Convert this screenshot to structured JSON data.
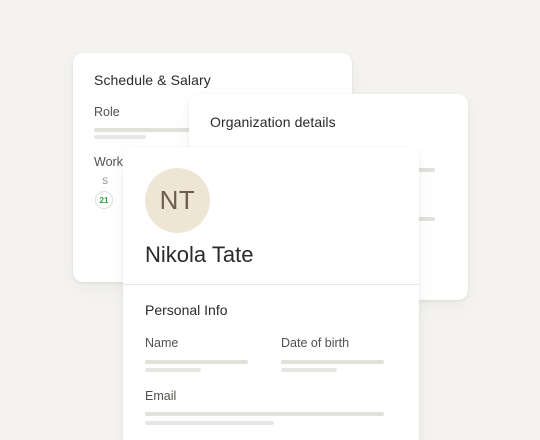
{
  "schedule_card": {
    "title": "Schedule & Salary",
    "role_label": "Role",
    "work_label": "Work",
    "day_letter": "S",
    "day_number": "21"
  },
  "org_card": {
    "title": "Organization details"
  },
  "profile_card": {
    "initials": "NT",
    "name": "Nikola Tate",
    "section_title": "Personal Info",
    "fields": {
      "name_label": "Name",
      "dob_label": "Date of birth",
      "email_label": "Email"
    }
  },
  "colors": {
    "background": "#f4f3f0",
    "card": "#ffffff",
    "avatar_bg": "#efe5d4",
    "day_accent": "#2f9e4b",
    "placeholder_bar": "#e2e0db"
  }
}
